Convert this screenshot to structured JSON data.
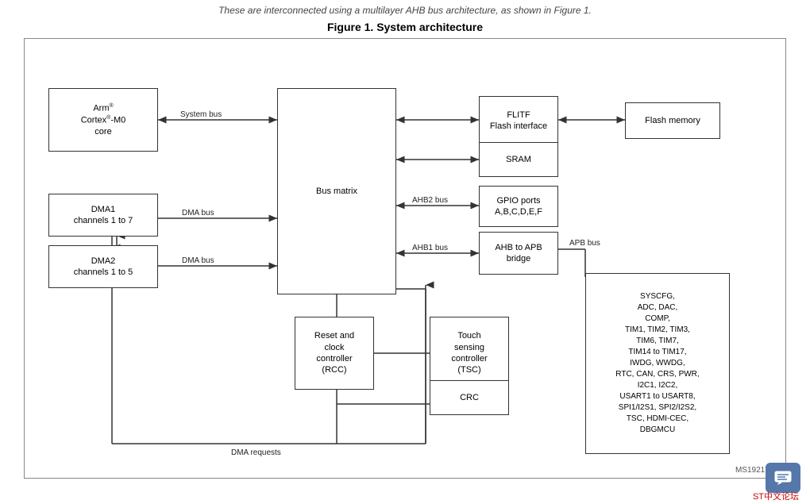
{
  "page": {
    "top_text": "These are interconnected using a multilayer AHB bus architecture, as shown in Figure 1.",
    "figure_title": "Figure 1. System architecture",
    "ms_label": "MS19217V5",
    "st_label": "ST中文论坛"
  },
  "blocks": {
    "arm_core": {
      "label": "Arm®\nCortex®-M0\ncore"
    },
    "bus_matrix": {
      "label": "Bus matrix"
    },
    "flitf": {
      "label": "FLITF\nFlash interface"
    },
    "flash_memory": {
      "label": "Flash memory"
    },
    "sram": {
      "label": "SRAM"
    },
    "gpio": {
      "label": "GPIO ports\nA,B,C,D,E,F"
    },
    "ahb_apb_bridge": {
      "label": "AHB to APB\nbridge"
    },
    "dma1": {
      "label": "DMA1\nchannels 1 to 7"
    },
    "dma2": {
      "label": "DMA2\nchannels 1 to 5"
    },
    "reset_clock": {
      "label": "Reset and\nclock\ncontroller\n(RCC)"
    },
    "touch": {
      "label": "Touch\nsensing\ncontroller\n(TSC)"
    },
    "crc": {
      "label": "CRC"
    },
    "peripherals": {
      "label": "SYSCFG,\nADC, DAC,\nCOMP,\nTIM1, TIM2, TIM3,\nTIM6, TIM7,\nTIM14 to TIM17,\nIWDG, WWDG,\nRTC, CAN, CRS, PWR,\nI2C1, I2C2,\nUSART1 to USART8,\nSPI1/I2S1, SPI2/I2S2,\nTSC, HDMI-CEC,\nDBGMCU"
    }
  },
  "labels": {
    "system_bus": "System bus",
    "dma_bus1": "DMA bus",
    "dma_bus2": "DMA bus",
    "ahb2_bus": "AHB2 bus",
    "ahb1_bus": "AHB1 bus",
    "apb_bus": "APB bus",
    "dma_requests": "DMA requests"
  }
}
